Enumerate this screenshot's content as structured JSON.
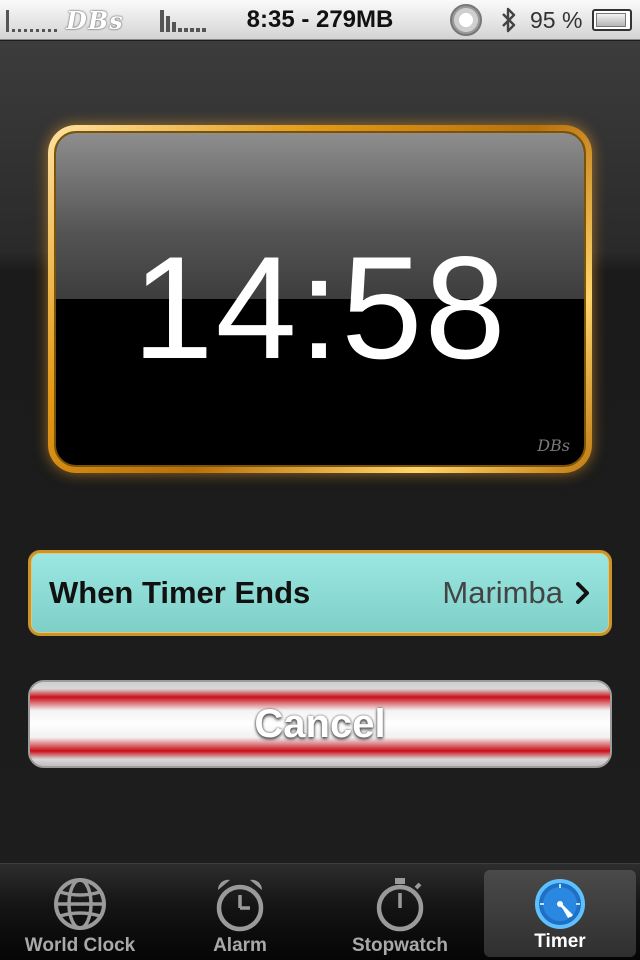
{
  "status_bar": {
    "carrier": "DBs",
    "time_memory": "8:35 - 279MB",
    "battery_percent": "95 %"
  },
  "timer": {
    "remaining": "14:58",
    "watermark": "DBs"
  },
  "when_timer_ends": {
    "label": "When Timer Ends",
    "value": "Marimba"
  },
  "cancel_button": {
    "label": "Cancel"
  },
  "tab_bar": {
    "tabs": [
      {
        "label": "World Clock",
        "icon": "globe-icon",
        "active": false
      },
      {
        "label": "Alarm",
        "icon": "alarm-clock-icon",
        "active": false
      },
      {
        "label": "Stopwatch",
        "icon": "stopwatch-icon",
        "active": false
      },
      {
        "label": "Timer",
        "icon": "timer-icon",
        "active": true
      }
    ]
  },
  "colors": {
    "frame_gold": "#e39a17",
    "row_teal": "#8edcd5",
    "cancel_red": "#c9101a",
    "active_tab_blue": "#3aa9ff"
  }
}
